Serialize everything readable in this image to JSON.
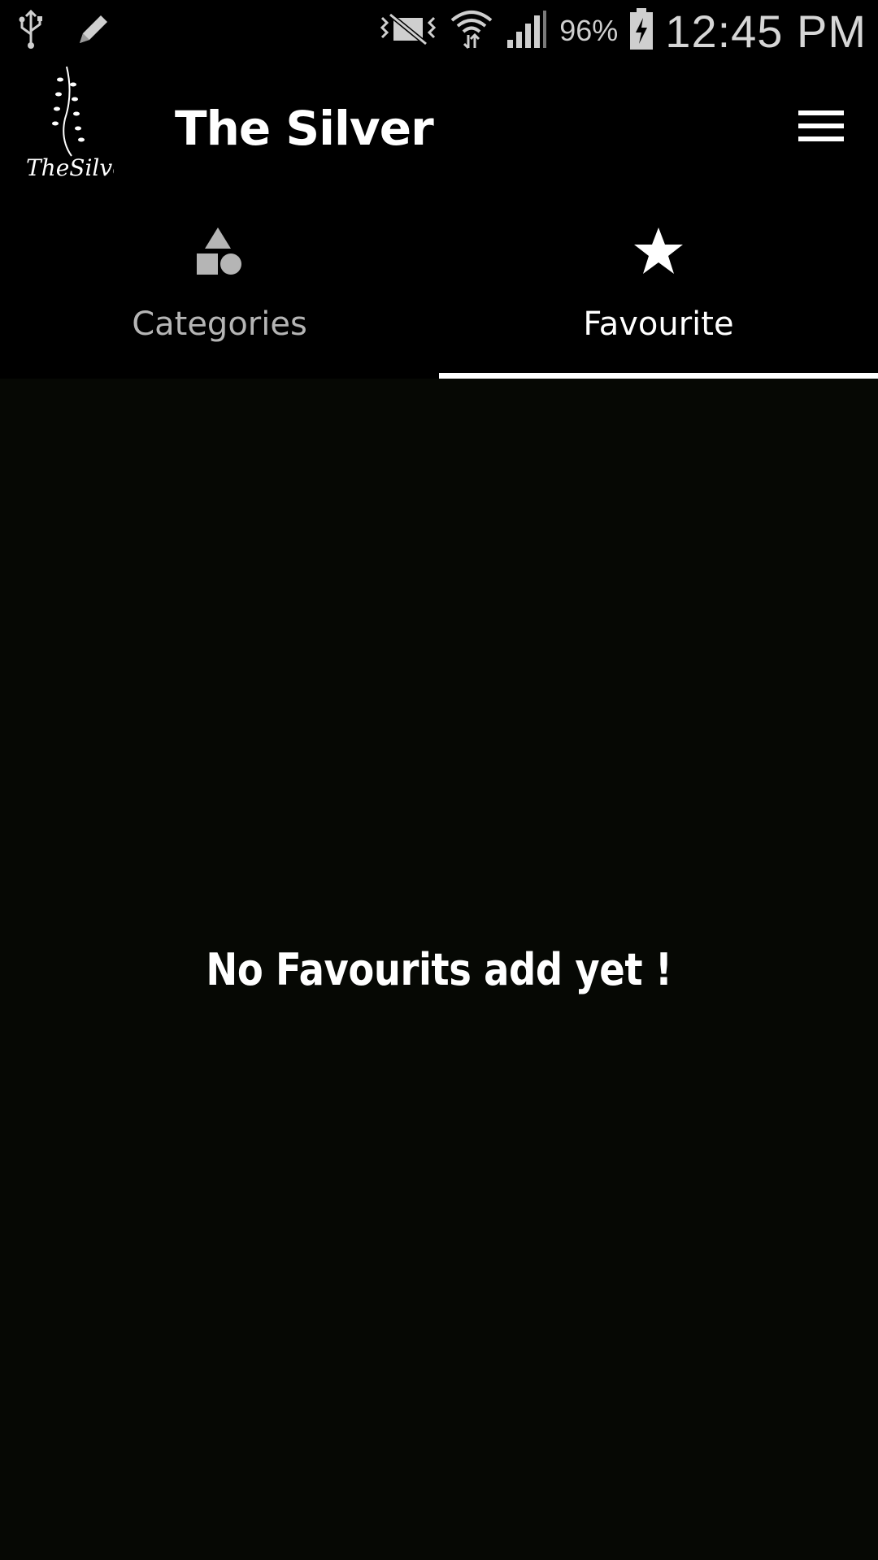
{
  "status_bar": {
    "left_icons": [
      "usb-icon",
      "pencil-icon"
    ],
    "right_icons": [
      "vibrate-mute-icon",
      "wifi-icon",
      "cell-signal-icon",
      "battery-charging-icon"
    ],
    "battery_percent": "96%",
    "time": "12:45 PM"
  },
  "app_bar": {
    "logo_text": "TheSilver",
    "title": "The Silver",
    "menu_icon": "hamburger-menu-icon"
  },
  "tabs": [
    {
      "label": "Categories",
      "icon": "shapes-icon",
      "selected": false
    },
    {
      "label": "Favourite",
      "icon": "star-icon",
      "selected": true
    }
  ],
  "content": {
    "empty_message": "No Favourits add yet !"
  },
  "colors": {
    "background": "#060804",
    "bar_background": "#000000",
    "active_text": "#ffffff",
    "inactive_text": "#b5b5b5"
  }
}
